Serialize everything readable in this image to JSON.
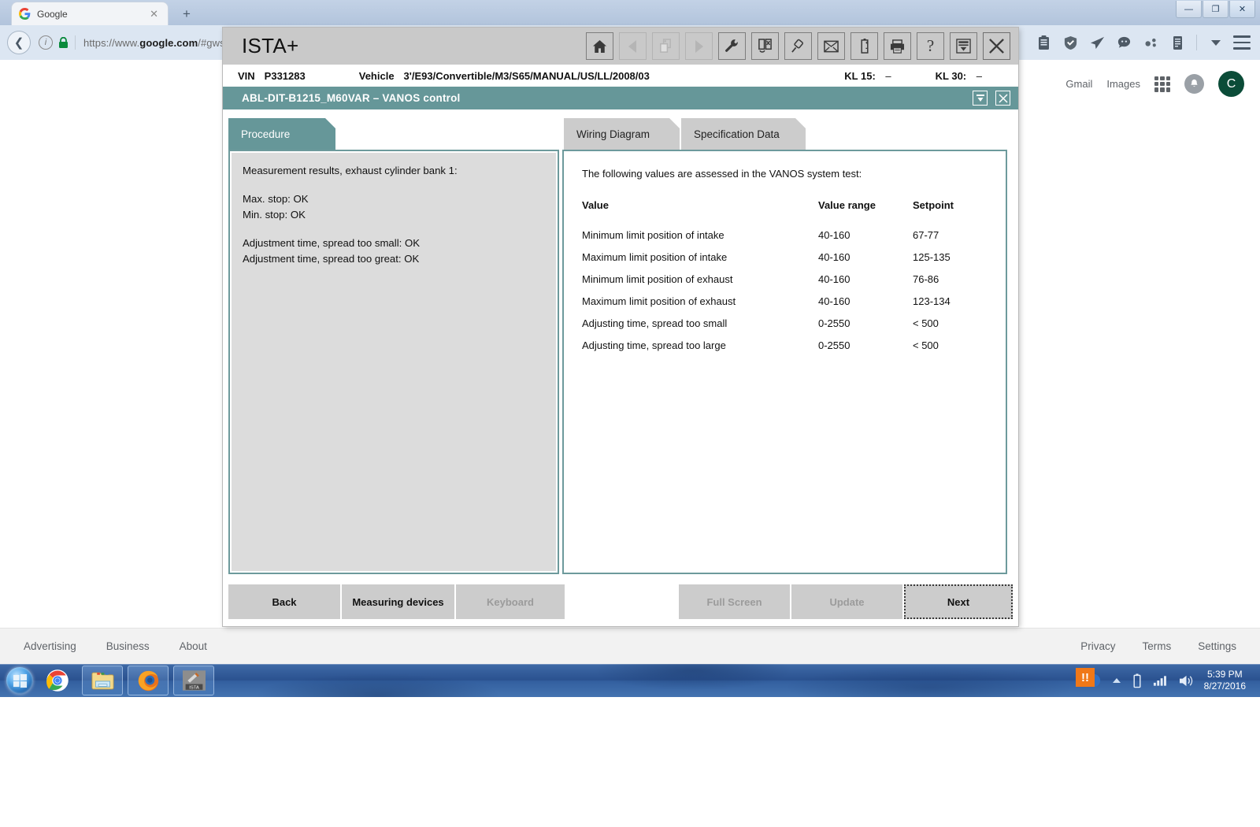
{
  "browser": {
    "tab": {
      "title": "Google",
      "favicon": "google-g-icon",
      "close": "✕"
    },
    "newtab_label": "+",
    "window_controls": {
      "minimize": "—",
      "maximize": "❐",
      "close": "✕"
    },
    "back_arrow": "❮",
    "url": {
      "scheme": "https://www.",
      "domain": "google.com",
      "path": "/#gws_rd=ss"
    },
    "extensions": [
      "clipboard-icon",
      "shield-icon",
      "send-icon",
      "chat-icon",
      "molecule-icon",
      "notes-icon",
      "chevron-down-icon"
    ],
    "menu": "hamburger-menu-icon"
  },
  "google_page": {
    "header_links": [
      "Gmail",
      "Images"
    ],
    "apps_icon": "grid-apps-icon",
    "bell_icon": "notification-bell-icon",
    "avatar_letter": "C",
    "footer_left": [
      "Advertising",
      "Business",
      "About"
    ],
    "footer_right": [
      "Privacy",
      "Terms",
      "Settings"
    ]
  },
  "ista": {
    "app_title": "ISTA+",
    "toolbar_icons": [
      {
        "name": "home-icon",
        "glyph": "home",
        "disabled": false
      },
      {
        "name": "back-arrow-icon",
        "glyph": "left",
        "disabled": true
      },
      {
        "name": "documents-icon",
        "glyph": "docs",
        "disabled": true
      },
      {
        "name": "forward-arrow-icon",
        "glyph": "right",
        "disabled": true
      },
      {
        "name": "wrench-icon",
        "glyph": "wrench",
        "disabled": false
      },
      {
        "name": "device-test-icon",
        "glyph": "device",
        "disabled": false
      },
      {
        "name": "connector-icon",
        "glyph": "plug",
        "disabled": false
      },
      {
        "name": "mail-icon",
        "glyph": "mail",
        "disabled": false
      },
      {
        "name": "battery-icon",
        "glyph": "battery",
        "disabled": false
      },
      {
        "name": "printer-icon",
        "glyph": "printer",
        "disabled": false
      },
      {
        "name": "help-icon",
        "glyph": "question",
        "disabled": false
      },
      {
        "name": "minimize-window-icon",
        "glyph": "minimize",
        "disabled": false
      },
      {
        "name": "close-window-icon",
        "glyph": "close",
        "disabled": false
      }
    ],
    "vehicle_bar": {
      "vin_label": "VIN",
      "vin_value": "P331283",
      "vehicle_label": "Vehicle",
      "vehicle_value": "3'/E93/Convertible/M3/S65/MANUAL/US/LL/2008/03",
      "kl15_label": "KL 15:",
      "kl15_value": "–",
      "kl30_label": "KL 30:",
      "kl30_value": "–"
    },
    "document_title": "ABL-DIT-B1215_M60VAR  –  VANOS control",
    "doc_buttons": {
      "minimize": "minimize-doc-icon",
      "close": "close-doc-icon"
    },
    "tabs": [
      {
        "label": "Procedure",
        "active": true
      },
      {
        "label": "Wiring Diagram",
        "active": false
      },
      {
        "label": "Specification Data",
        "active": false
      }
    ],
    "procedure_lines": [
      "Measurement results, exhaust cylinder bank 1:",
      "",
      "Max. stop: OK",
      "Min. stop: OK",
      "",
      "Adjustment time, spread too small: OK",
      "Adjustment time, spread too great: OK"
    ],
    "spec": {
      "intro": "The following values are assessed in the VANOS system test:",
      "headers": [
        "Value",
        "Value range",
        "Setpoint"
      ],
      "rows": [
        [
          "Minimum limit position of intake",
          "40-160",
          "67-77"
        ],
        [
          "Maximum limit position of intake",
          "40-160",
          "125-135"
        ],
        [
          "Minimum limit position of exhaust",
          "40-160",
          "76-86"
        ],
        [
          "Maximum limit position of exhaust",
          "40-160",
          "123-134"
        ],
        [
          "Adjusting time, spread too small",
          "0-2550",
          "< 500"
        ],
        [
          "Adjusting time, spread too large",
          "0-2550",
          "< 500"
        ]
      ]
    },
    "buttons": [
      {
        "label": "Back",
        "disabled": false,
        "focused": false
      },
      {
        "label": "Measuring devices",
        "disabled": false,
        "focused": false
      },
      {
        "label": "Keyboard",
        "disabled": true,
        "focused": false
      },
      {
        "label": "Full Screen",
        "disabled": true,
        "focused": false
      },
      {
        "label": "Update",
        "disabled": true,
        "focused": false
      },
      {
        "label": "Next",
        "disabled": false,
        "focused": true
      }
    ]
  },
  "taskbar": {
    "start": "windows-start-orb",
    "items": [
      "chrome-icon",
      "explorer-icon",
      "firefox-icon",
      "ista-icon"
    ],
    "tray": [
      "action-center-icon",
      "show-hidden-icons-icon",
      "battery-icon",
      "network-icon",
      "volume-icon"
    ],
    "alert_glyph": "!!",
    "time": "5:39 PM",
    "date": "8/27/2016"
  },
  "colors": {
    "ista_teal": "#669799",
    "ista_gray": "#c9c9c9",
    "pane_border": "#6d9a9c",
    "panel_bg": "#dcdcdc",
    "taskbar_blue": "#2c5a9c",
    "avatar_green": "#0b4c38"
  }
}
